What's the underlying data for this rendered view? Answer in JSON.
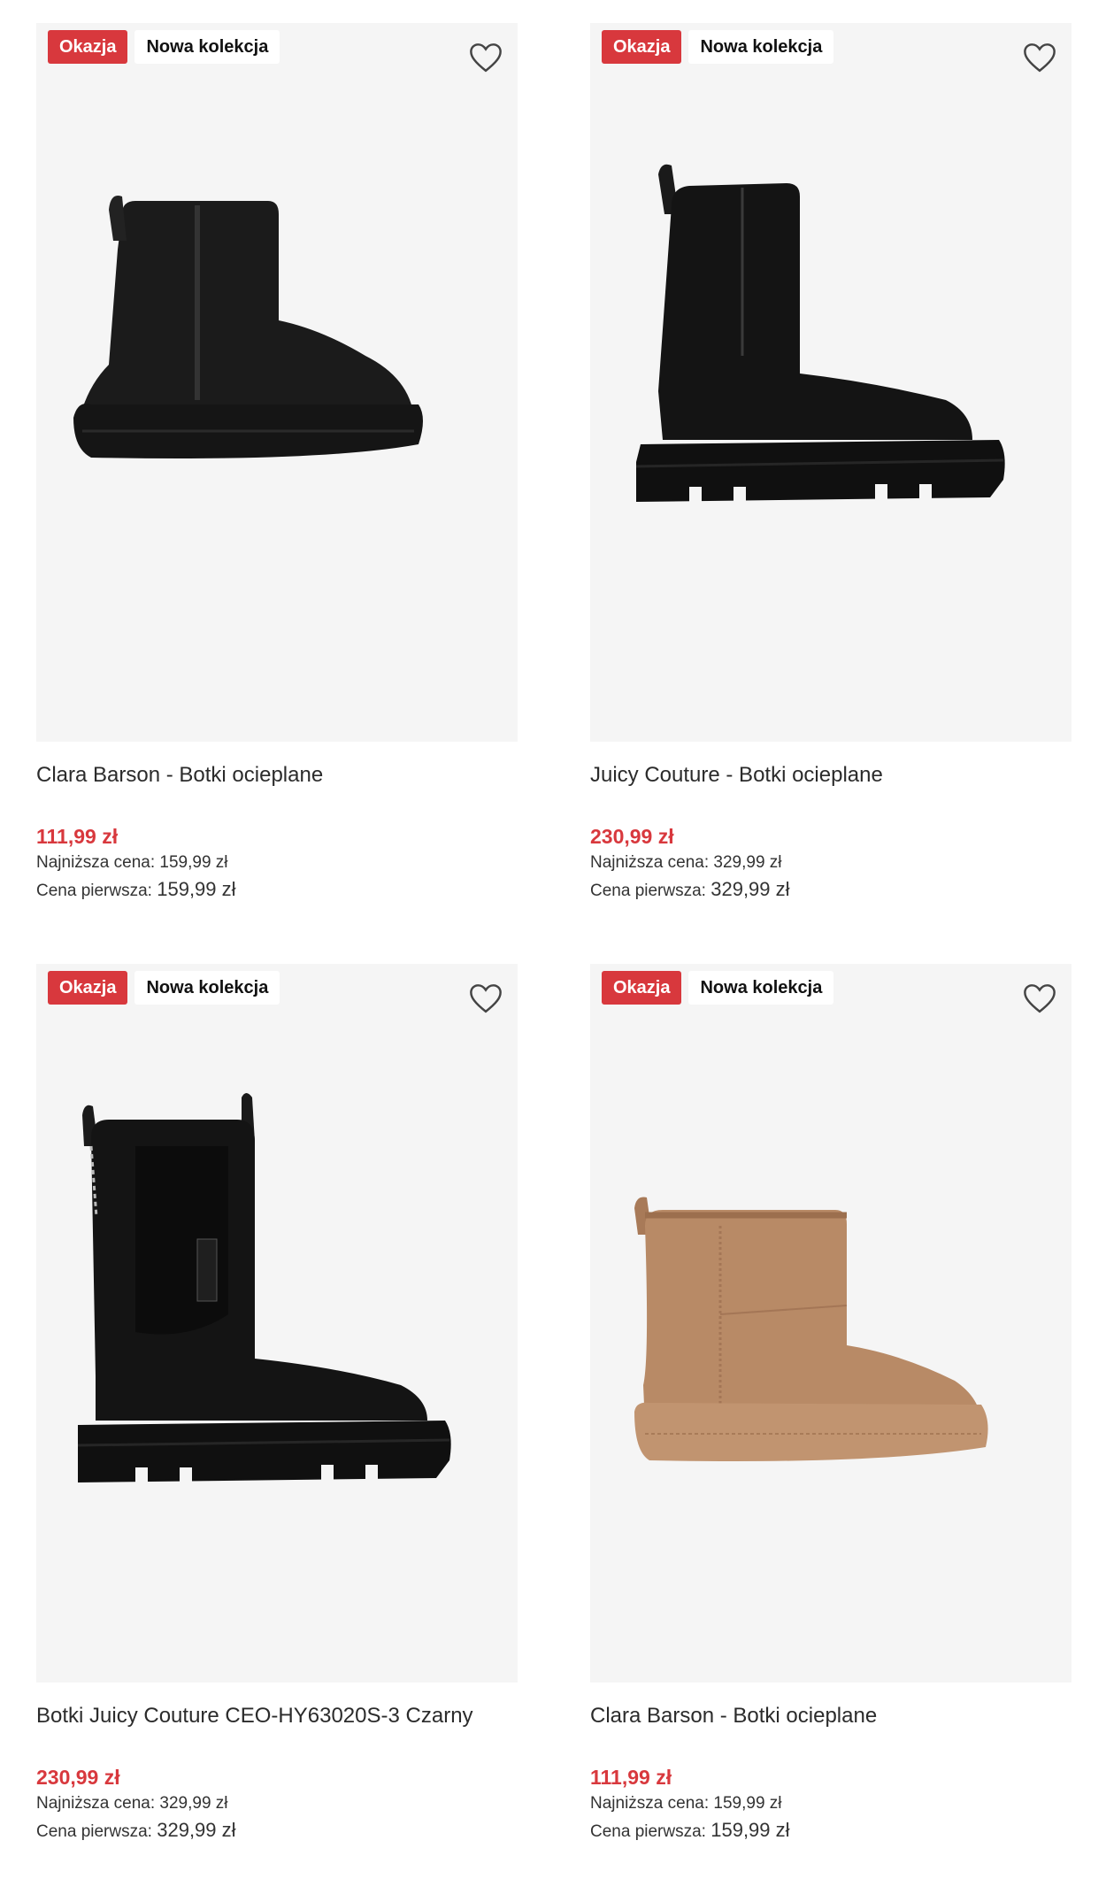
{
  "products": [
    {
      "badge_sale": "Okazja",
      "badge_new": "Nowa kolekcja",
      "name": "Clara Barson - Botki ocieplane",
      "price": "111,99 zł",
      "lowest_label": "Najniższa cena:",
      "lowest_value": "159,99 zł",
      "first_label": "Cena pierwsza:",
      "first_value": "159,99 zł",
      "boot_color": "#1b1b1b",
      "sole_color": "#151515"
    },
    {
      "badge_sale": "Okazja",
      "badge_new": "Nowa kolekcja",
      "name": "Juicy Couture - Botki ocieplane",
      "price": "230,99 zł",
      "lowest_label": "Najniższa cena:",
      "lowest_value": "329,99 zł",
      "first_label": "Cena pierwsza:",
      "first_value": "329,99 zł",
      "boot_color": "#141414",
      "sole_color": "#101010"
    },
    {
      "badge_sale": "Okazja",
      "badge_new": "Nowa kolekcja",
      "name": "Botki Juicy Couture CEO-HY63020S-3 Czarny",
      "price": "230,99 zł",
      "lowest_label": "Najniższa cena:",
      "lowest_value": "329,99 zł",
      "first_label": "Cena pierwsza:",
      "first_value": "329,99 zł",
      "boot_color": "#141414",
      "sole_color": "#101010"
    },
    {
      "badge_sale": "Okazja",
      "badge_new": "Nowa kolekcja",
      "name": "Clara Barson - Botki ocieplane",
      "price": "111,99 zł",
      "lowest_label": "Najniższa cena:",
      "lowest_value": "159,99 zł",
      "first_label": "Cena pierwsza:",
      "first_value": "159,99 zł",
      "boot_color": "#b88a66",
      "sole_color": "#c19470"
    }
  ],
  "icons": {
    "favorite": "heart-outline-icon"
  },
  "colors": {
    "sale_red": "#d8383d",
    "image_bg": "#f5f5f5"
  }
}
